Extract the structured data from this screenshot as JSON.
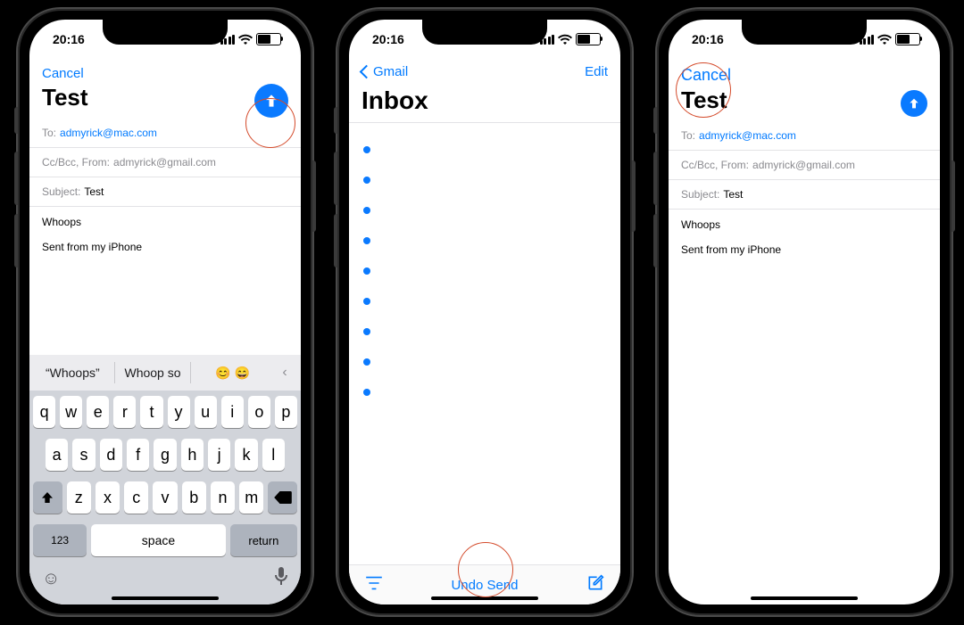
{
  "status": {
    "time": "20:16"
  },
  "phone1": {
    "cancel": "Cancel",
    "title": "Test",
    "to_label": "To:",
    "to_email": "admyrick@mac.com",
    "cc_label": "Cc/Bcc, From:",
    "cc_email": "admyrick@gmail.com",
    "subject_label": "Subject:",
    "subject_value": "Test",
    "body_line1": "Whoops",
    "body_line2": "Sent from my iPhone",
    "predictions": {
      "p1": "“Whoops”",
      "p2": "Whoop so",
      "p3": "😊   😄"
    },
    "keyboard": {
      "row1": [
        "q",
        "w",
        "e",
        "r",
        "t",
        "y",
        "u",
        "i",
        "o",
        "p"
      ],
      "row2": [
        "a",
        "s",
        "d",
        "f",
        "g",
        "h",
        "j",
        "k",
        "l"
      ],
      "row3": [
        "z",
        "x",
        "c",
        "v",
        "b",
        "n",
        "m"
      ],
      "num": "123",
      "space": "space",
      "ret": "return"
    }
  },
  "phone2": {
    "back": "Gmail",
    "edit": "Edit",
    "title": "Inbox",
    "undo": "Undo Send"
  },
  "phone3": {
    "cancel": "Cancel",
    "title": "Test",
    "to_label": "To:",
    "to_email": "admyrick@mac.com",
    "cc_label": "Cc/Bcc, From:",
    "cc_email": "admyrick@gmail.com",
    "subject_label": "Subject:",
    "subject_value": "Test",
    "body_line1": "Whoops",
    "body_line2": "Sent from my iPhone"
  }
}
